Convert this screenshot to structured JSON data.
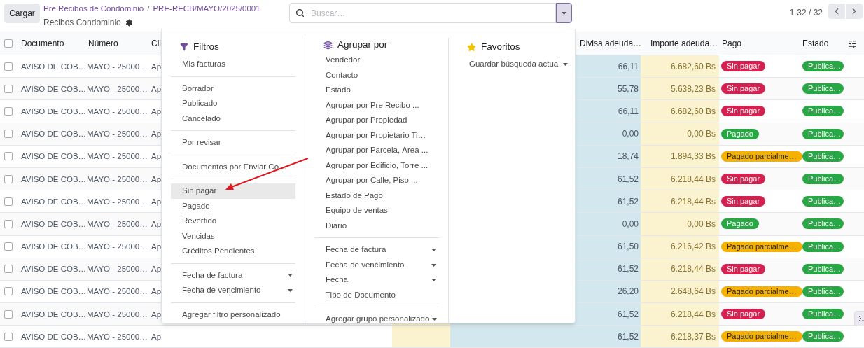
{
  "toolbar": {
    "load_button": "Cargar",
    "breadcrumb": [
      "Pre Recibos de Condominio",
      "PRE-RECB/MAYO/2025/0001"
    ],
    "separator": "/",
    "subtitle": "Recibos Condominio"
  },
  "search": {
    "placeholder": "Buscar…"
  },
  "pager": {
    "range": "1-32 / 32"
  },
  "table": {
    "all_checked": false,
    "columns": [
      "Documento",
      "Número",
      "Cli",
      "Divisa adeuda…",
      "Importe adeuda…",
      "Pago",
      "Estado"
    ],
    "rows": [
      {
        "checked": false,
        "documento": "AVISO DE COB…",
        "numero": "MAYO - 25000…",
        "cliente": "Ap",
        "divisa": "66,11",
        "importe": "6.682,60 Bs",
        "pago": {
          "label": "Sin pagar",
          "kind": "unpaid"
        },
        "estado": {
          "label": "Publica…",
          "kind": "posted"
        }
      },
      {
        "checked": false,
        "documento": "AVISO DE COB…",
        "numero": "MAYO - 25000…",
        "cliente": "Ap",
        "divisa": "55,78",
        "importe": "5.638,23 Bs",
        "pago": {
          "label": "Sin pagar",
          "kind": "unpaid"
        },
        "estado": {
          "label": "Publica…",
          "kind": "posted"
        }
      },
      {
        "checked": false,
        "documento": "AVISO DE COB…",
        "numero": "MAYO - 25000…",
        "cliente": "Ap",
        "divisa": "66,11",
        "importe": "6.682,60 Bs",
        "pago": {
          "label": "Sin pagar",
          "kind": "unpaid"
        },
        "estado": {
          "label": "Publica…",
          "kind": "posted"
        }
      },
      {
        "checked": false,
        "documento": "AVISO DE COB…",
        "numero": "MAYO - 25000…",
        "cliente": "Ap",
        "divisa": "0,00",
        "importe": "0,00 Bs",
        "pago": {
          "label": "Pagado",
          "kind": "paid"
        },
        "estado": {
          "label": "Publica…",
          "kind": "posted"
        }
      },
      {
        "checked": false,
        "documento": "AVISO DE COB…",
        "numero": "MAYO - 25000…",
        "cliente": "Ap",
        "divisa": "18,74",
        "importe": "1.894,33 Bs",
        "pago": {
          "label": "Pagado parcialme…",
          "kind": "partial"
        },
        "estado": {
          "label": "Publica…",
          "kind": "posted"
        }
      },
      {
        "checked": false,
        "documento": "AVISO DE COB…",
        "numero": "MAYO - 25000…",
        "cliente": "Ap",
        "divisa": "61,52",
        "importe": "6.218,44 Bs",
        "pago": {
          "label": "Sin pagar",
          "kind": "unpaid"
        },
        "estado": {
          "label": "Publica…",
          "kind": "posted"
        }
      },
      {
        "checked": false,
        "documento": "AVISO DE COB…",
        "numero": "MAYO - 25000…",
        "cliente": "Ap",
        "divisa": "61,52",
        "importe": "6.218,44 Bs",
        "pago": {
          "label": "Sin pagar",
          "kind": "unpaid"
        },
        "estado": {
          "label": "Publica…",
          "kind": "posted"
        }
      },
      {
        "checked": false,
        "documento": "AVISO DE COB…",
        "numero": "MAYO - 25000…",
        "cliente": "Ap",
        "divisa": "0,00",
        "importe": "0,00 Bs",
        "pago": {
          "label": "Pagado",
          "kind": "paid"
        },
        "estado": {
          "label": "Publica…",
          "kind": "posted"
        }
      },
      {
        "checked": false,
        "documento": "AVISO DE COB…",
        "numero": "MAYO - 25000…",
        "cliente": "Ap",
        "divisa": "61,50",
        "importe": "6.216,42 Bs",
        "pago": {
          "label": "Pagado parcialme…",
          "kind": "partial"
        },
        "estado": {
          "label": "Publica…",
          "kind": "posted"
        }
      },
      {
        "checked": false,
        "documento": "AVISO DE COB…",
        "numero": "MAYO - 25000…",
        "cliente": "Ap",
        "divisa": "61,52",
        "importe": "6.218,44 Bs",
        "pago": {
          "label": "Sin pagar",
          "kind": "unpaid"
        },
        "estado": {
          "label": "Publica…",
          "kind": "posted"
        }
      },
      {
        "checked": false,
        "documento": "AVISO DE COB…",
        "numero": "MAYO - 25000…",
        "cliente": "Ap",
        "divisa": "26,20",
        "importe": "2.648,64 Bs",
        "pago": {
          "label": "Pagado parcialme…",
          "kind": "partial"
        },
        "estado": {
          "label": "Publica…",
          "kind": "posted"
        }
      },
      {
        "checked": false,
        "documento": "AVISO DE COB…",
        "numero": "MAYO - 25000…",
        "cliente": "Ap",
        "divisa": "61,52",
        "importe": "6.218,44 Bs",
        "pago": {
          "label": "Sin pagar",
          "kind": "unpaid"
        },
        "estado": {
          "label": "Publica…",
          "kind": "posted"
        }
      },
      {
        "checked": false,
        "documento": "AVISO DE COB…",
        "numero": "MAYO - 25000…",
        "cliente": "Ap",
        "divisa": "61,52",
        "importe": "6.218,37 Bs",
        "pago": {
          "label": "Pagado parcialme…",
          "kind": "partial"
        },
        "estado": {
          "label": "Publica…",
          "kind": "posted"
        }
      }
    ]
  },
  "dropdown": {
    "sections": [
      {
        "kind": "filters",
        "title": "Filtros",
        "groups": [
          [
            {
              "label": "Mis facturas",
              "kind": "option",
              "selected": false
            }
          ],
          [
            {
              "label": "Borrador",
              "kind": "option",
              "selected": false
            },
            {
              "label": "Publicado",
              "kind": "option",
              "selected": false
            },
            {
              "label": "Cancelado",
              "kind": "option",
              "selected": false
            }
          ],
          [
            {
              "label": "Por revisar",
              "kind": "option",
              "selected": false
            }
          ],
          [
            {
              "label": "Documentos por Enviar Co…",
              "kind": "option",
              "selected": false
            }
          ],
          [
            {
              "label": "Sin pagar",
              "kind": "option",
              "selected": true
            },
            {
              "label": "Pagado",
              "kind": "option",
              "selected": false
            },
            {
              "label": "Revertido",
              "kind": "option",
              "selected": false
            },
            {
              "label": "Vencidas",
              "kind": "option",
              "selected": false
            },
            {
              "label": "Créditos Pendientes",
              "kind": "option",
              "selected": false
            }
          ],
          [
            {
              "label": "Fecha de factura",
              "kind": "submenu",
              "selected": false
            },
            {
              "label": "Fecha de vencimiento",
              "kind": "submenu",
              "selected": false
            }
          ],
          [
            {
              "label": "Agregar filtro personalizado",
              "kind": "option",
              "selected": false
            }
          ]
        ]
      },
      {
        "kind": "groupby",
        "title": "Agrupar por",
        "groups": [
          [
            {
              "label": "Vendedor",
              "kind": "option",
              "selected": false
            },
            {
              "label": "Contacto",
              "kind": "option",
              "selected": false
            },
            {
              "label": "Estado",
              "kind": "option",
              "selected": false
            },
            {
              "label": "Agrupar por Pre Recibo ...",
              "kind": "option",
              "selected": false
            },
            {
              "label": "Agrupar por Propiedad",
              "kind": "option",
              "selected": false
            },
            {
              "label": "Agrupar por Propietario Ti…",
              "kind": "option",
              "selected": false
            },
            {
              "label": "Agrupar por Parcela, Área ...",
              "kind": "option",
              "selected": false
            },
            {
              "label": "Agrupar por Edificio, Torre ...",
              "kind": "option",
              "selected": false
            },
            {
              "label": "Agrupar por Calle, Piso ...",
              "kind": "option",
              "selected": false
            },
            {
              "label": "Estado de Pago",
              "kind": "option",
              "selected": false
            },
            {
              "label": "Equipo de ventas",
              "kind": "option",
              "selected": false
            },
            {
              "label": "Diario",
              "kind": "option",
              "selected": false
            }
          ],
          [
            {
              "label": "Fecha de factura",
              "kind": "submenu",
              "selected": false
            },
            {
              "label": "Fecha de vencimiento",
              "kind": "submenu",
              "selected": false
            },
            {
              "label": "Fecha",
              "kind": "submenu",
              "selected": false
            },
            {
              "label": "Tipo de Documento",
              "kind": "option",
              "selected": false
            }
          ],
          [
            {
              "label": "Agregar grupo personalizado",
              "kind": "dropdown",
              "selected": false
            }
          ]
        ]
      },
      {
        "kind": "favorites",
        "title": "Favoritos",
        "groups": [
          [
            {
              "label": "Guardar búsqueda actual",
              "kind": "dropdown",
              "selected": false
            }
          ]
        ]
      }
    ]
  }
}
